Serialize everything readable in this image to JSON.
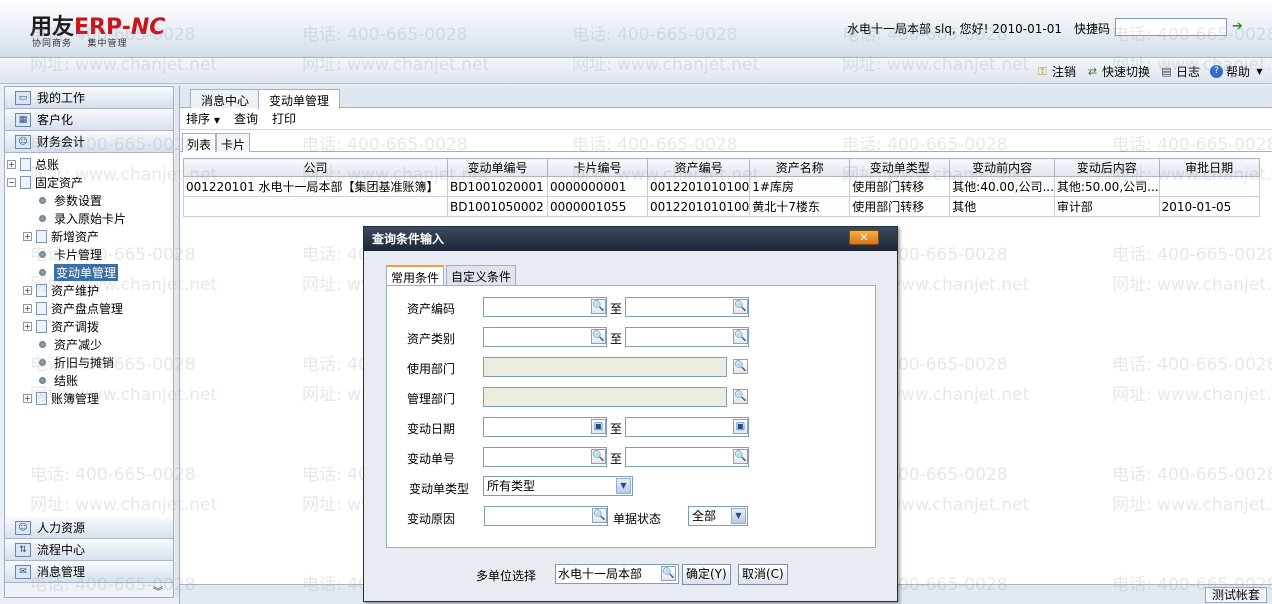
{
  "header": {
    "logo_main": "用友",
    "logo_erp": "ERP-",
    "logo_nc": "NC",
    "logo_sub": "协同商务    集中管理",
    "user_info": "水电十一局本部 slq, 您好! 2010-01-01",
    "quick_code_label": "快捷码",
    "quick_code_value": ""
  },
  "menu_bar": {
    "logout": "注销",
    "quick_switch": "快速切换",
    "log": "日志",
    "help": "帮助"
  },
  "nav": {
    "my_work": "我的工作",
    "customize": "客户化",
    "finance": "财务会计",
    "hr": "人力资源",
    "flow": "流程中心",
    "message": "消息管理"
  },
  "tree": {
    "ledger": "总账",
    "fixed_assets": "固定资产",
    "params": "参数设置",
    "enter_cards": "录入原始卡片",
    "new_assets": "新增资产",
    "card_mgmt": "卡片管理",
    "change_mgmt": "变动单管理",
    "maintenance": "资产维护",
    "inventory": "资产盘点管理",
    "transfer": "资产调拨",
    "reduce": "资产减少",
    "depreciation": "折旧与摊销",
    "close": "结账",
    "books": "账簿管理"
  },
  "tabs": {
    "msg_center": "消息中心",
    "change_mgmt": "变动单管理"
  },
  "toolbar": {
    "sort": "排序",
    "query": "查询",
    "print": "打印"
  },
  "subtabs": {
    "list": "列表",
    "card": "卡片"
  },
  "table": {
    "headers": [
      "公司",
      "变动单编号",
      "卡片编号",
      "资产编号",
      "资产名称",
      "变动单类型",
      "变动前内容",
      "变动后内容",
      "审批日期"
    ],
    "rows": [
      [
        "001220101 水电十一局本部【集团基准账簿】",
        "BD1001020001",
        "0000000001",
        "0012201010100",
        "1#库房",
        "使用部门转移",
        "其他:40.00,公司...",
        "其他:50.00,公司...",
        ""
      ],
      [
        "",
        "BD1001050002",
        "0000001055",
        "0012201010100",
        "黄北十7楼东",
        "使用部门转移",
        "其他",
        "审计部",
        "2010-01-05"
      ]
    ]
  },
  "status": {
    "account": "测试帐套"
  },
  "dialog": {
    "title": "查询条件输入",
    "close": "✕",
    "tab_common": "常用条件",
    "tab_custom": "自定义条件",
    "to": "至",
    "asset_code": "资产编码",
    "asset_type": "资产类别",
    "use_dept": "使用部门",
    "manage_dept": "管理部门",
    "change_date": "变动日期",
    "change_no": "变动单号",
    "change_type": "变动单类型",
    "change_type_value": "所有类型",
    "change_reason": "变动原因",
    "doc_status": "单据状态",
    "doc_status_value": "全部",
    "multi_unit": "多单位选择",
    "multi_unit_value": "水电十一局本部",
    "ok": "确定(Y)",
    "cancel": "取消(C)"
  },
  "watermark": {
    "phone": "电话: 400-665-0028",
    "site": "网址: www.chanjet.net"
  }
}
